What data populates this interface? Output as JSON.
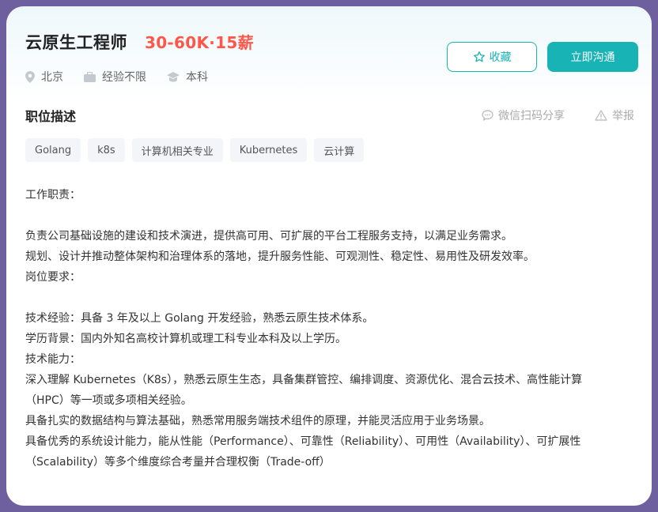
{
  "job": {
    "title": "云原生工程师",
    "salary": "30-60K·15薪",
    "meta": {
      "location": "北京",
      "experience": "经验不限",
      "education": "本科"
    }
  },
  "actions": {
    "favorite_label": "收藏",
    "chat_label": "立即沟通"
  },
  "section": {
    "title": "职位描述",
    "share_label": "微信扫码分享",
    "report_label": "举报"
  },
  "tags": [
    "Golang",
    "k8s",
    "计算机相关专业",
    "Kubernetes",
    "云计算"
  ],
  "description": {
    "lines": [
      "工作职责：",
      "",
      "负责公司基础设施的建设和技术演进，提供高可用、可扩展的平台工程服务支持，以满足业务需求。",
      "规划、设计并推动整体架构和治理体系的落地，提升服务性能、可观测性、稳定性、易用性及研发效率。",
      "岗位要求：",
      "",
      "技术经验：具备 3 年及以上 Golang 开发经验，熟悉云原生技术体系。",
      "学历背景：国内外知名高校计算机或理工科专业本科及以上学历。",
      "技术能力：",
      "深入理解 Kubernetes（K8s），熟悉云原生生态，具备集群管控、编排调度、资源优化、混合云技术、高性能计算",
      "（HPC）等一项或多项相关经验。",
      "具备扎实的数据结构与算法基础，熟悉常用服务端技术组件的原理，并能灵活应用于业务场景。",
      "具备优秀的系统设计能力，能从性能（Performance）、可靠性（Reliability）、可用性（Availability）、可扩展性",
      "（Scalability）等多个维度综合考量并合理权衡（Trade-off）"
    ]
  },
  "colors": {
    "accent": "#18b3b4",
    "salary": "#fe574a",
    "frame": "#6e5f9e"
  }
}
